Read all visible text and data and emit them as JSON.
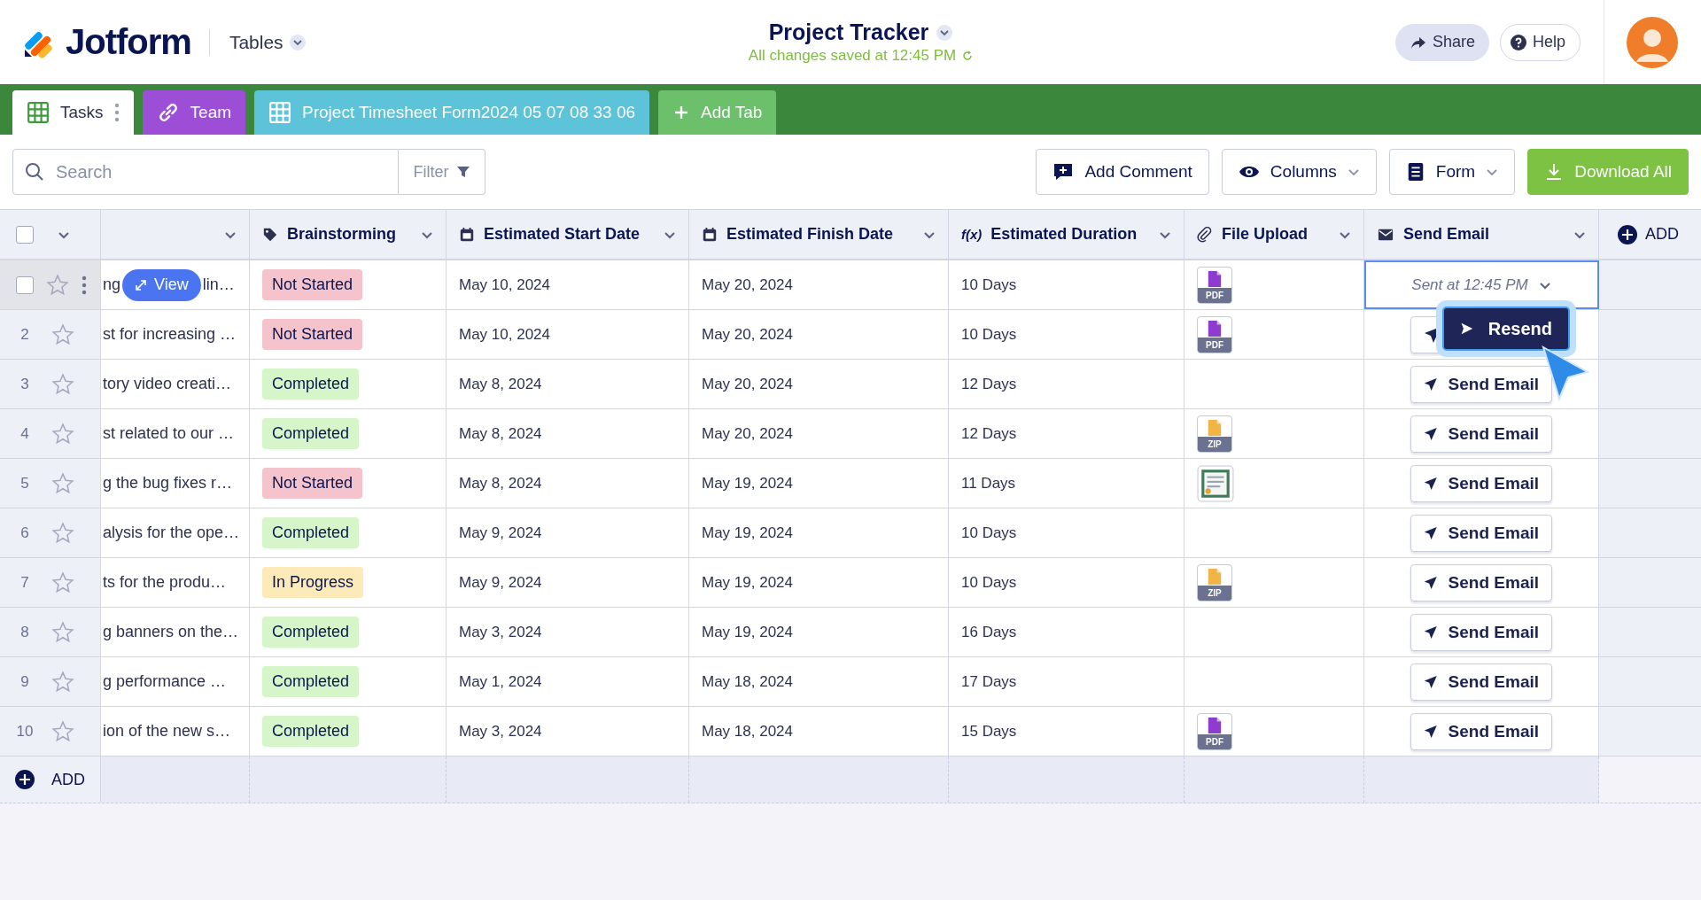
{
  "header": {
    "logo": "Jotform",
    "section": "Tables",
    "title": "Project Tracker",
    "saved": "All changes saved at 12:45 PM",
    "share": "Share",
    "help": "Help"
  },
  "tabs": [
    {
      "label": "Tasks",
      "color": "#ffffff",
      "selected": true
    },
    {
      "label": "Team",
      "color": "#9c4fd6",
      "selected": false
    },
    {
      "label": "Project Timesheet Form2024 05 07 08 33 06",
      "color": "#5cc3d8",
      "selected": false
    }
  ],
  "add_tab": "Add Tab",
  "toolbar": {
    "search_placeholder": "Search",
    "filter": "Filter",
    "buttons": [
      {
        "label": "Add Comment",
        "kind": "outline"
      },
      {
        "label": "Columns",
        "kind": "dropdown"
      },
      {
        "label": "Form",
        "kind": "dropdown"
      },
      {
        "label": "Download All",
        "kind": "primary"
      }
    ]
  },
  "table": {
    "header_checkbox": {
      "checked": false
    },
    "columns": [
      {},
      {
        "label": "Brainstorming"
      },
      {
        "label": "Estimated Start Date"
      },
      {
        "label": "Estimated Finish Date"
      },
      {
        "label": "Estimated Duration",
        "icon_label": "f(x)"
      },
      {
        "label": "File Upload"
      },
      {
        "label": "Send Email"
      }
    ],
    "add_column": "ADD",
    "rows": [
      {
        "kind": "hover",
        "checked": false,
        "task_left": "ng",
        "view": "View",
        "task": "lin…",
        "status": "Not Started",
        "color": "#f4c3cb",
        "start": "May 10, 2024",
        "finish": "May 20, 2024",
        "duration": "10 Days",
        "file": {
          "kind": "pdf",
          "label": "PDF"
        },
        "email": {
          "kind": "sent",
          "label": "Sent at 12:45 PM"
        }
      },
      {
        "kind": "plain",
        "number": "2",
        "task": "st for increasing …",
        "status": "Not Started",
        "color": "#f4c3cb",
        "start": "May 10, 2024",
        "finish": "May 20, 2024",
        "duration": "10 Days",
        "file": {
          "kind": "pdf",
          "label": "PDF"
        },
        "email": {
          "kind": "covered"
        }
      },
      {
        "kind": "plain",
        "number": "3",
        "task": "tory video creati…",
        "status": "Completed",
        "color": "#d6f5c9",
        "start": "May 8, 2024",
        "finish": "May 20, 2024",
        "duration": "12 Days",
        "file": {
          "kind": "none"
        },
        "email": {
          "kind": "button",
          "label": "Send Email"
        }
      },
      {
        "kind": "plain",
        "number": "4",
        "task": "st related to our …",
        "status": "Completed",
        "color": "#d6f5c9",
        "start": "May 8, 2024",
        "finish": "May 20, 2024",
        "duration": "12 Days",
        "file": {
          "kind": "zip",
          "label": "ZIP"
        },
        "email": {
          "kind": "button",
          "label": "Send Email"
        }
      },
      {
        "kind": "plain",
        "number": "5",
        "task": "g the bug fixes r…",
        "status": "Not Started",
        "color": "#f4c3cb",
        "start": "May 8, 2024",
        "finish": "May 19, 2024",
        "duration": "11 Days",
        "email": {
          "kind": "button",
          "label": "Send Email"
        }
      },
      {
        "kind": "plain",
        "number": "6",
        "task": "alysis for the ope…",
        "status": "Completed",
        "color": "#d6f5c9",
        "start": "May 9, 2024",
        "finish": "May 19, 2024",
        "duration": "10 Days",
        "file": {
          "kind": "none"
        },
        "email": {
          "kind": "button",
          "label": "Send Email"
        }
      },
      {
        "kind": "plain",
        "number": "7",
        "task": "ts for the produ…",
        "status": "In Progress",
        "color": "#fcebb9",
        "start": "May 9, 2024",
        "finish": "May 19, 2024",
        "duration": "10 Days",
        "file": {
          "kind": "zip",
          "label": "ZIP"
        },
        "email": {
          "kind": "button",
          "label": "Send Email"
        }
      },
      {
        "kind": "plain",
        "number": "8",
        "task": "g banners on the…",
        "status": "Completed",
        "color": "#d6f5c9",
        "start": "May 3, 2024",
        "finish": "May 19, 2024",
        "duration": "16 Days",
        "file": {
          "kind": "none"
        },
        "email": {
          "kind": "button",
          "label": "Send Email"
        }
      },
      {
        "kind": "plain",
        "number": "9",
        "task": "g performance …",
        "status": "Completed",
        "color": "#d6f5c9",
        "start": "May 1, 2024",
        "finish": "May 18, 2024",
        "duration": "17 Days",
        "file": {
          "kind": "none"
        },
        "email": {
          "kind": "button",
          "label": "Send Email"
        }
      },
      {
        "kind": "plain",
        "number": "10",
        "task": "ion of the new s…",
        "status": "Completed",
        "color": "#d6f5c9",
        "start": "May 3, 2024",
        "finish": "May 18, 2024",
        "duration": "15 Days",
        "file": {
          "kind": "pdf",
          "label": "PDF"
        },
        "email": {
          "kind": "button",
          "label": "Send Email"
        }
      }
    ],
    "add_row": "ADD"
  },
  "popup": {
    "label": "Resend"
  }
}
